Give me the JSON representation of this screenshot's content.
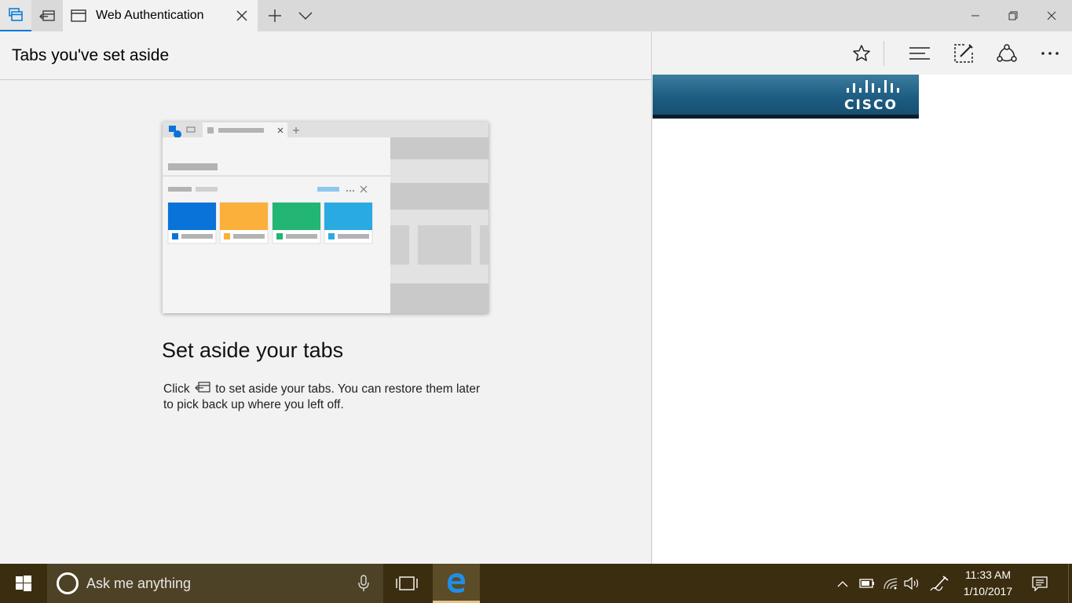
{
  "window": {
    "tab_title": "Web Authentication",
    "tab_manager_icon": "tab-manager-icon",
    "set_aside_icon": "set-aside-tabs-icon",
    "new_tab_icon": "plus-icon",
    "tab_preview_icon": "chevron-down-icon"
  },
  "set_aside_panel": {
    "title": "Tabs you've set aside",
    "heading": "Set aside your tabs",
    "desc_before": "Click",
    "desc_after": "to set aside your tabs. You can restore them later to pick back up where you left off.",
    "illustration_colors": [
      "#0a73d9",
      "#fbb03b",
      "#22b573",
      "#29abe2"
    ]
  },
  "toolbar": {
    "icons": [
      "star-icon",
      "hub-icon",
      "web-note-icon",
      "share-icon",
      "more-icon"
    ],
    "more_label": "..."
  },
  "webpage": {
    "logo_text": "CISCO",
    "banner_color": "#1d5e82"
  },
  "taskbar": {
    "search_placeholder": "Ask me anything",
    "time": "11:33 AM",
    "date": "1/10/2017"
  }
}
